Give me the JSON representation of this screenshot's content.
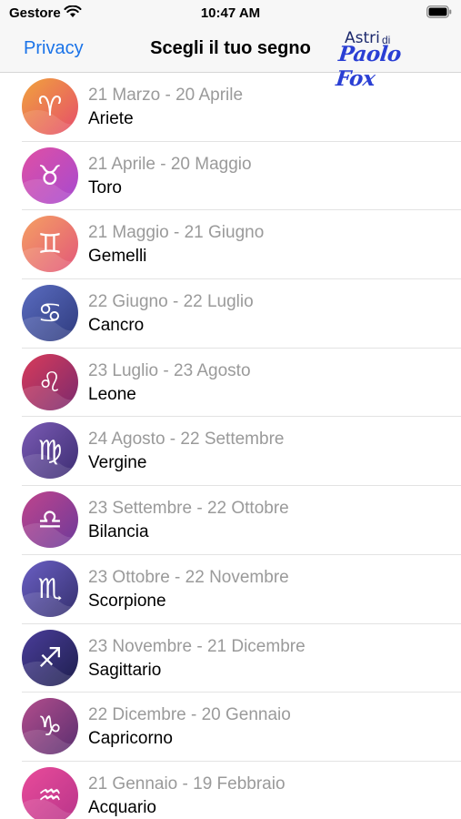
{
  "status_bar": {
    "carrier": "Gestore",
    "time": "10:47 AM"
  },
  "nav": {
    "privacy_label": "Privacy",
    "title": "Scegli il tuo segno",
    "logo_astri": "Astri",
    "logo_di": "di",
    "logo_brand": "Paolo Fox"
  },
  "signs": [
    {
      "dates": "21 Marzo - 20 Aprile",
      "name": "Ariete",
      "icon": "aries-icon",
      "glyph": "♈",
      "c1": "#f0a33c",
      "c2": "#e64d6b"
    },
    {
      "dates": "21 Aprile - 20 Maggio",
      "name": "Toro",
      "icon": "taurus-icon",
      "glyph": "♉",
      "c1": "#e04fa4",
      "c2": "#a64ad0"
    },
    {
      "dates": "21 Maggio - 21 Giugno",
      "name": "Gemelli",
      "icon": "gemini-icon",
      "glyph": "♊",
      "c1": "#f5a062",
      "c2": "#e2577a"
    },
    {
      "dates": "22 Giugno - 22 Luglio",
      "name": "Cancro",
      "icon": "cancer-icon",
      "glyph": "♋",
      "c1": "#5a6cc0",
      "c2": "#2f3b7e"
    },
    {
      "dates": "23 Luglio - 23 Agosto",
      "name": "Leone",
      "icon": "leo-icon",
      "glyph": "♌",
      "c1": "#d93b5a",
      "c2": "#7a2a6e"
    },
    {
      "dates": "24 Agosto - 22 Settembre",
      "name": "Vergine",
      "icon": "virgo-icon",
      "glyph": "♍",
      "c1": "#7b5bb5",
      "c2": "#3c2d72"
    },
    {
      "dates": "23 Settembre - 22 Ottobre",
      "name": "Bilancia",
      "icon": "libra-icon",
      "glyph": "♎",
      "c1": "#c0448c",
      "c2": "#6c3a9a"
    },
    {
      "dates": "23 Ottobre - 22 Novembre",
      "name": "Scorpione",
      "icon": "scorpio-icon",
      "glyph": "♏",
      "c1": "#6a5fc4",
      "c2": "#35306e"
    },
    {
      "dates": "23 Novembre - 21 Dicembre",
      "name": "Sagittario",
      "icon": "sagittarius-icon",
      "glyph": "♐",
      "c1": "#4a3d9a",
      "c2": "#1e1f4e"
    },
    {
      "dates": "22 Dicembre - 20 Gennaio",
      "name": "Capricorno",
      "icon": "capricorn-icon",
      "glyph": "♑",
      "c1": "#b24d8c",
      "c2": "#5a2f70"
    },
    {
      "dates": "21 Gennaio - 19 Febbraio",
      "name": "Acquario",
      "icon": "aquarius-icon",
      "glyph": "♒",
      "c1": "#e94b9a",
      "c2": "#b8358a"
    }
  ]
}
